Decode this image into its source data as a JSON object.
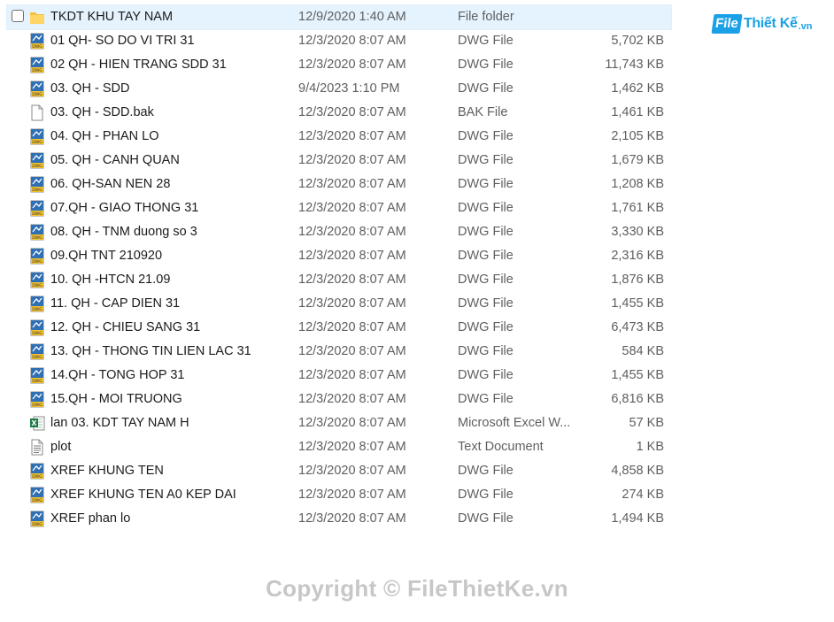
{
  "logo": {
    "mark": "File",
    "text": "Thiết Kế",
    "ext": ".vn"
  },
  "watermark": "Copyright © FileThietKe.vn",
  "colors": {
    "selection": "#e5f3ff",
    "folder": "#f4c042",
    "dwg": "#2f6fb3",
    "excel": "#1d7a45",
    "logo": "#1aa0e6"
  },
  "files": [
    {
      "name": "TKDT KHU TAY NAM",
      "date": "12/9/2020 1:40 AM",
      "type": "File folder",
      "size": "",
      "icon": "folder-icon",
      "selected": true
    },
    {
      "name": "01 QH- SO DO VI TRI 31",
      "date": "12/3/2020 8:07 AM",
      "type": "DWG File",
      "size": "5,702 KB",
      "icon": "dwg-file-icon"
    },
    {
      "name": "02 QH - HIEN TRANG SDD 31",
      "date": "12/3/2020 8:07 AM",
      "type": "DWG File",
      "size": "11,743 KB",
      "icon": "dwg-file-icon"
    },
    {
      "name": "03. QH - SDD",
      "date": "9/4/2023 1:10 PM",
      "type": "DWG File",
      "size": "1,462 KB",
      "icon": "dwg-file-icon"
    },
    {
      "name": "03. QH - SDD.bak",
      "date": "12/3/2020 8:07 AM",
      "type": "BAK File",
      "size": "1,461 KB",
      "icon": "blank-file-icon"
    },
    {
      "name": "04. QH - PHAN LO",
      "date": "12/3/2020 8:07 AM",
      "type": "DWG File",
      "size": "2,105 KB",
      "icon": "dwg-file-icon"
    },
    {
      "name": "05. QH - CANH QUAN",
      "date": "12/3/2020 8:07 AM",
      "type": "DWG File",
      "size": "1,679 KB",
      "icon": "dwg-file-icon"
    },
    {
      "name": "06. QH-SAN NEN 28",
      "date": "12/3/2020 8:07 AM",
      "type": "DWG File",
      "size": "1,208 KB",
      "icon": "dwg-file-icon"
    },
    {
      "name": "07.QH - GIAO THONG 31",
      "date": "12/3/2020 8:07 AM",
      "type": "DWG File",
      "size": "1,761 KB",
      "icon": "dwg-file-icon"
    },
    {
      "name": "08. QH - TNM duong so 3",
      "date": "12/3/2020 8:07 AM",
      "type": "DWG File",
      "size": "3,330 KB",
      "icon": "dwg-file-icon"
    },
    {
      "name": "09.QH TNT 210920",
      "date": "12/3/2020 8:07 AM",
      "type": "DWG File",
      "size": "2,316 KB",
      "icon": "dwg-file-icon"
    },
    {
      "name": "10. QH -HTCN 21.09",
      "date": "12/3/2020 8:07 AM",
      "type": "DWG File",
      "size": "1,876 KB",
      "icon": "dwg-file-icon"
    },
    {
      "name": "11. QH - CAP DIEN 31",
      "date": "12/3/2020 8:07 AM",
      "type": "DWG File",
      "size": "1,455 KB",
      "icon": "dwg-file-icon"
    },
    {
      "name": "12. QH - CHIEU SANG 31",
      "date": "12/3/2020 8:07 AM",
      "type": "DWG File",
      "size": "6,473 KB",
      "icon": "dwg-file-icon"
    },
    {
      "name": "13. QH - THONG TIN LIEN LAC 31",
      "date": "12/3/2020 8:07 AM",
      "type": "DWG File",
      "size": "584 KB",
      "icon": "dwg-file-icon"
    },
    {
      "name": "14.QH - TONG HOP 31",
      "date": "12/3/2020 8:07 AM",
      "type": "DWG File",
      "size": "1,455 KB",
      "icon": "dwg-file-icon"
    },
    {
      "name": "15.QH - MOI TRUONG",
      "date": "12/3/2020 8:07 AM",
      "type": "DWG File",
      "size": "6,816 KB",
      "icon": "dwg-file-icon"
    },
    {
      "name": "lan 03. KDT TAY NAM H",
      "date": "12/3/2020 8:07 AM",
      "type": "Microsoft Excel W...",
      "size": "57 KB",
      "icon": "excel-file-icon"
    },
    {
      "name": "plot",
      "date": "12/3/2020 8:07 AM",
      "type": "Text Document",
      "size": "1 KB",
      "icon": "text-file-icon"
    },
    {
      "name": "XREF KHUNG TEN",
      "date": "12/3/2020 8:07 AM",
      "type": "DWG File",
      "size": "4,858 KB",
      "icon": "dwg-file-icon"
    },
    {
      "name": "XREF KHUNG TEN A0 KEP DAI",
      "date": "12/3/2020 8:07 AM",
      "type": "DWG File",
      "size": "274 KB",
      "icon": "dwg-file-icon"
    },
    {
      "name": "XREF phan lo",
      "date": "12/3/2020 8:07 AM",
      "type": "DWG File",
      "size": "1,494 KB",
      "icon": "dwg-file-icon"
    }
  ]
}
